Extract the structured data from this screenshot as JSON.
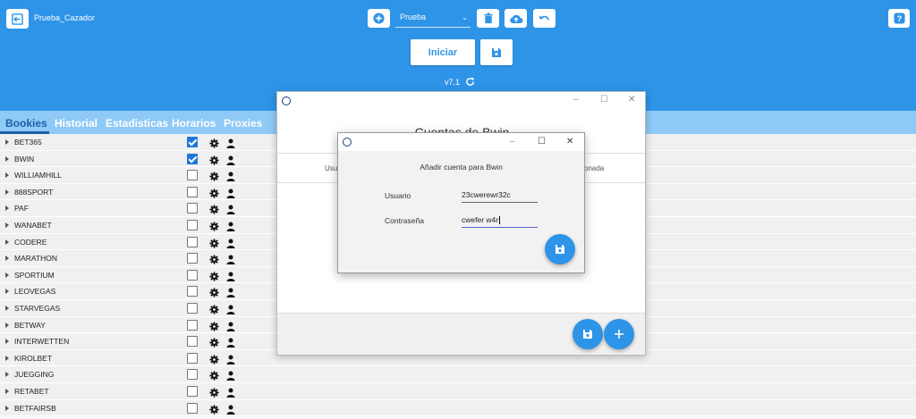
{
  "app": {
    "title": "Prueba_Cazador",
    "version": "v7.1"
  },
  "toolbar": {
    "profile_selected": "Prueba",
    "start_label": "Iniciar"
  },
  "tabs": [
    {
      "label": "Bookies",
      "active": true
    },
    {
      "label": "Historial",
      "active": false
    },
    {
      "label": "Estadisticas",
      "active": false
    },
    {
      "label": "Horarios",
      "active": false
    },
    {
      "label": "Proxies",
      "active": false
    }
  ],
  "bookies": [
    {
      "name": "BET365",
      "checked": true
    },
    {
      "name": "BWIN",
      "checked": true
    },
    {
      "name": "WILLIAMHILL",
      "checked": false
    },
    {
      "name": "888SPORT",
      "checked": false
    },
    {
      "name": "PAF",
      "checked": false
    },
    {
      "name": "WANABET",
      "checked": false
    },
    {
      "name": "CODERE",
      "checked": false
    },
    {
      "name": "MARATHON",
      "checked": false
    },
    {
      "name": "SPORTIUM",
      "checked": false
    },
    {
      "name": "LEOVEGAS",
      "checked": false
    },
    {
      "name": "STARVEGAS",
      "checked": false
    },
    {
      "name": "BETWAY",
      "checked": false
    },
    {
      "name": "INTERWETTEN",
      "checked": false
    },
    {
      "name": "KIROLBET",
      "checked": false
    },
    {
      "name": "JUEGGING",
      "checked": false
    },
    {
      "name": "RETABET",
      "checked": false
    },
    {
      "name": "BETFAIRSB",
      "checked": false
    }
  ],
  "accounts_window": {
    "title": "Cuentas de Bwin",
    "col_left": "Usu",
    "col_right": "onada"
  },
  "add_dialog": {
    "subtitle": "Añadir cuenta para Bwin",
    "user_label": "Usuario",
    "user_value": "23cwerewr32c",
    "pass_label": "Contraseña",
    "pass_value": "cwefer w4r"
  },
  "colors": {
    "accent": "#2e94e8",
    "tab_bar": "#8ecaf5",
    "active_tab": "#1a5fa8",
    "checkbox_on": "#1e78d7"
  }
}
